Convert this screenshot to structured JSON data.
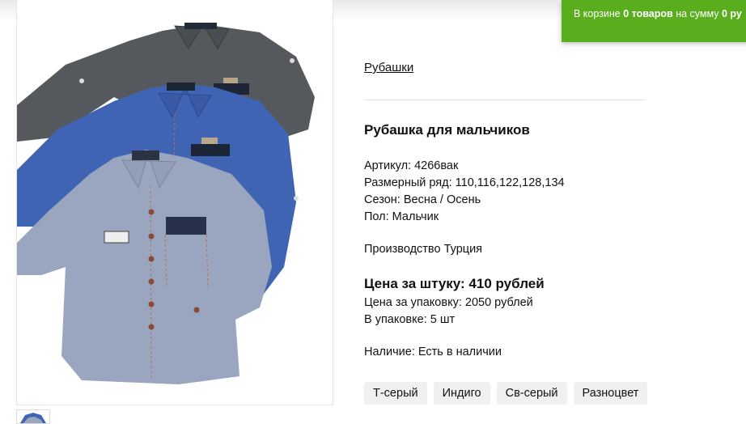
{
  "cart": {
    "prefix": "В корзине",
    "count": "0 товаров",
    "middle": "на сумму",
    "sum": "0 ру"
  },
  "breadcrumb": "Рубашки",
  "product": {
    "title": "Рубашка для мальчиков",
    "specs": [
      "Артикул: 4266вак",
      "Размерный ряд: 110,116,122,128,134",
      "Сезон: Весна / Осень",
      "Пол: Мальчик"
    ],
    "origin": "Производство Турция",
    "price_unit": "Цена за штуку: 410 рублей",
    "price_pack": "Цена за упаковку: 2050 рублей",
    "pack_size": "В упаковке: 5 шт",
    "availability": "Наличие: Есть в наличии"
  },
  "colors": [
    "Т-серый",
    "Индиго",
    "Св-серый",
    "Разноцвет"
  ],
  "image": {
    "subject": "three shirts: dark grey, indigo blue, light grey",
    "colors": {
      "dark": "#55585c",
      "blue": "#3f64b4",
      "light": "#9aa6bf"
    }
  },
  "theme": {
    "cart_green": "#5aae1d",
    "chip_bg": "#f0f0f0"
  }
}
